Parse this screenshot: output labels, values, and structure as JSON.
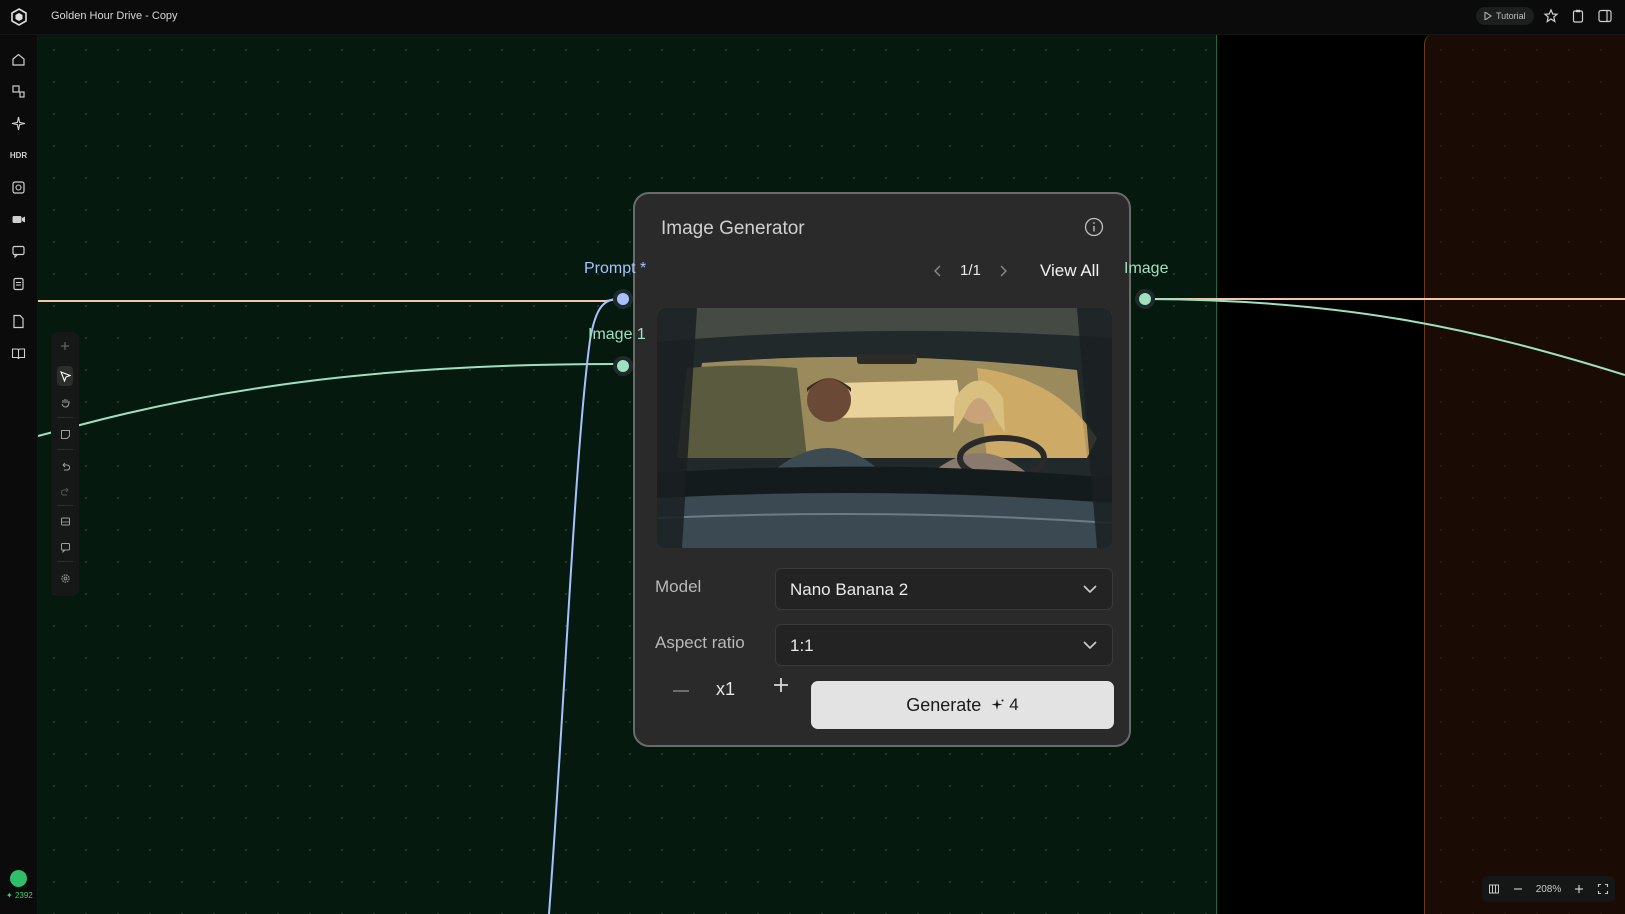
{
  "header": {
    "title": "Golden Hour Drive - Copy",
    "tutorial_label": "Tutorial"
  },
  "sidebar": {
    "icons": [
      "home-icon",
      "nodes-icon",
      "sparkle-icon",
      "hdr-icon",
      "frame-icon",
      "video-icon",
      "chat-icon",
      "clipboard-icon",
      "document-icon",
      "book-icon"
    ],
    "hdr_label": "HDR",
    "credits": "2392"
  },
  "toolbar": {
    "tools": [
      "add-icon",
      "select-icon",
      "pan-icon",
      "sticky-note-icon",
      "undo-icon",
      "redo-icon",
      "media-icon",
      "comment-icon",
      "settings-icon"
    ]
  },
  "node": {
    "title": "Image Generator",
    "pager": "1/1",
    "view_all_label": "View All",
    "inputs": {
      "prompt_label": "Prompt *",
      "image_label": "Image 1"
    },
    "output_label": "Image",
    "model_label": "Model",
    "model_value": "Nano Banana 2",
    "aspect_label": "Aspect ratio",
    "aspect_value": "1:1",
    "quantity": "x1",
    "generate_label": "Generate",
    "generate_cost": "4"
  },
  "zoom": {
    "level": "208%"
  },
  "colors": {
    "accent_green": "#3ccf78",
    "wire_orange": "#f2c7a8",
    "wire_green": "#9fe0c0",
    "wire_blue": "#a8c2ff"
  }
}
